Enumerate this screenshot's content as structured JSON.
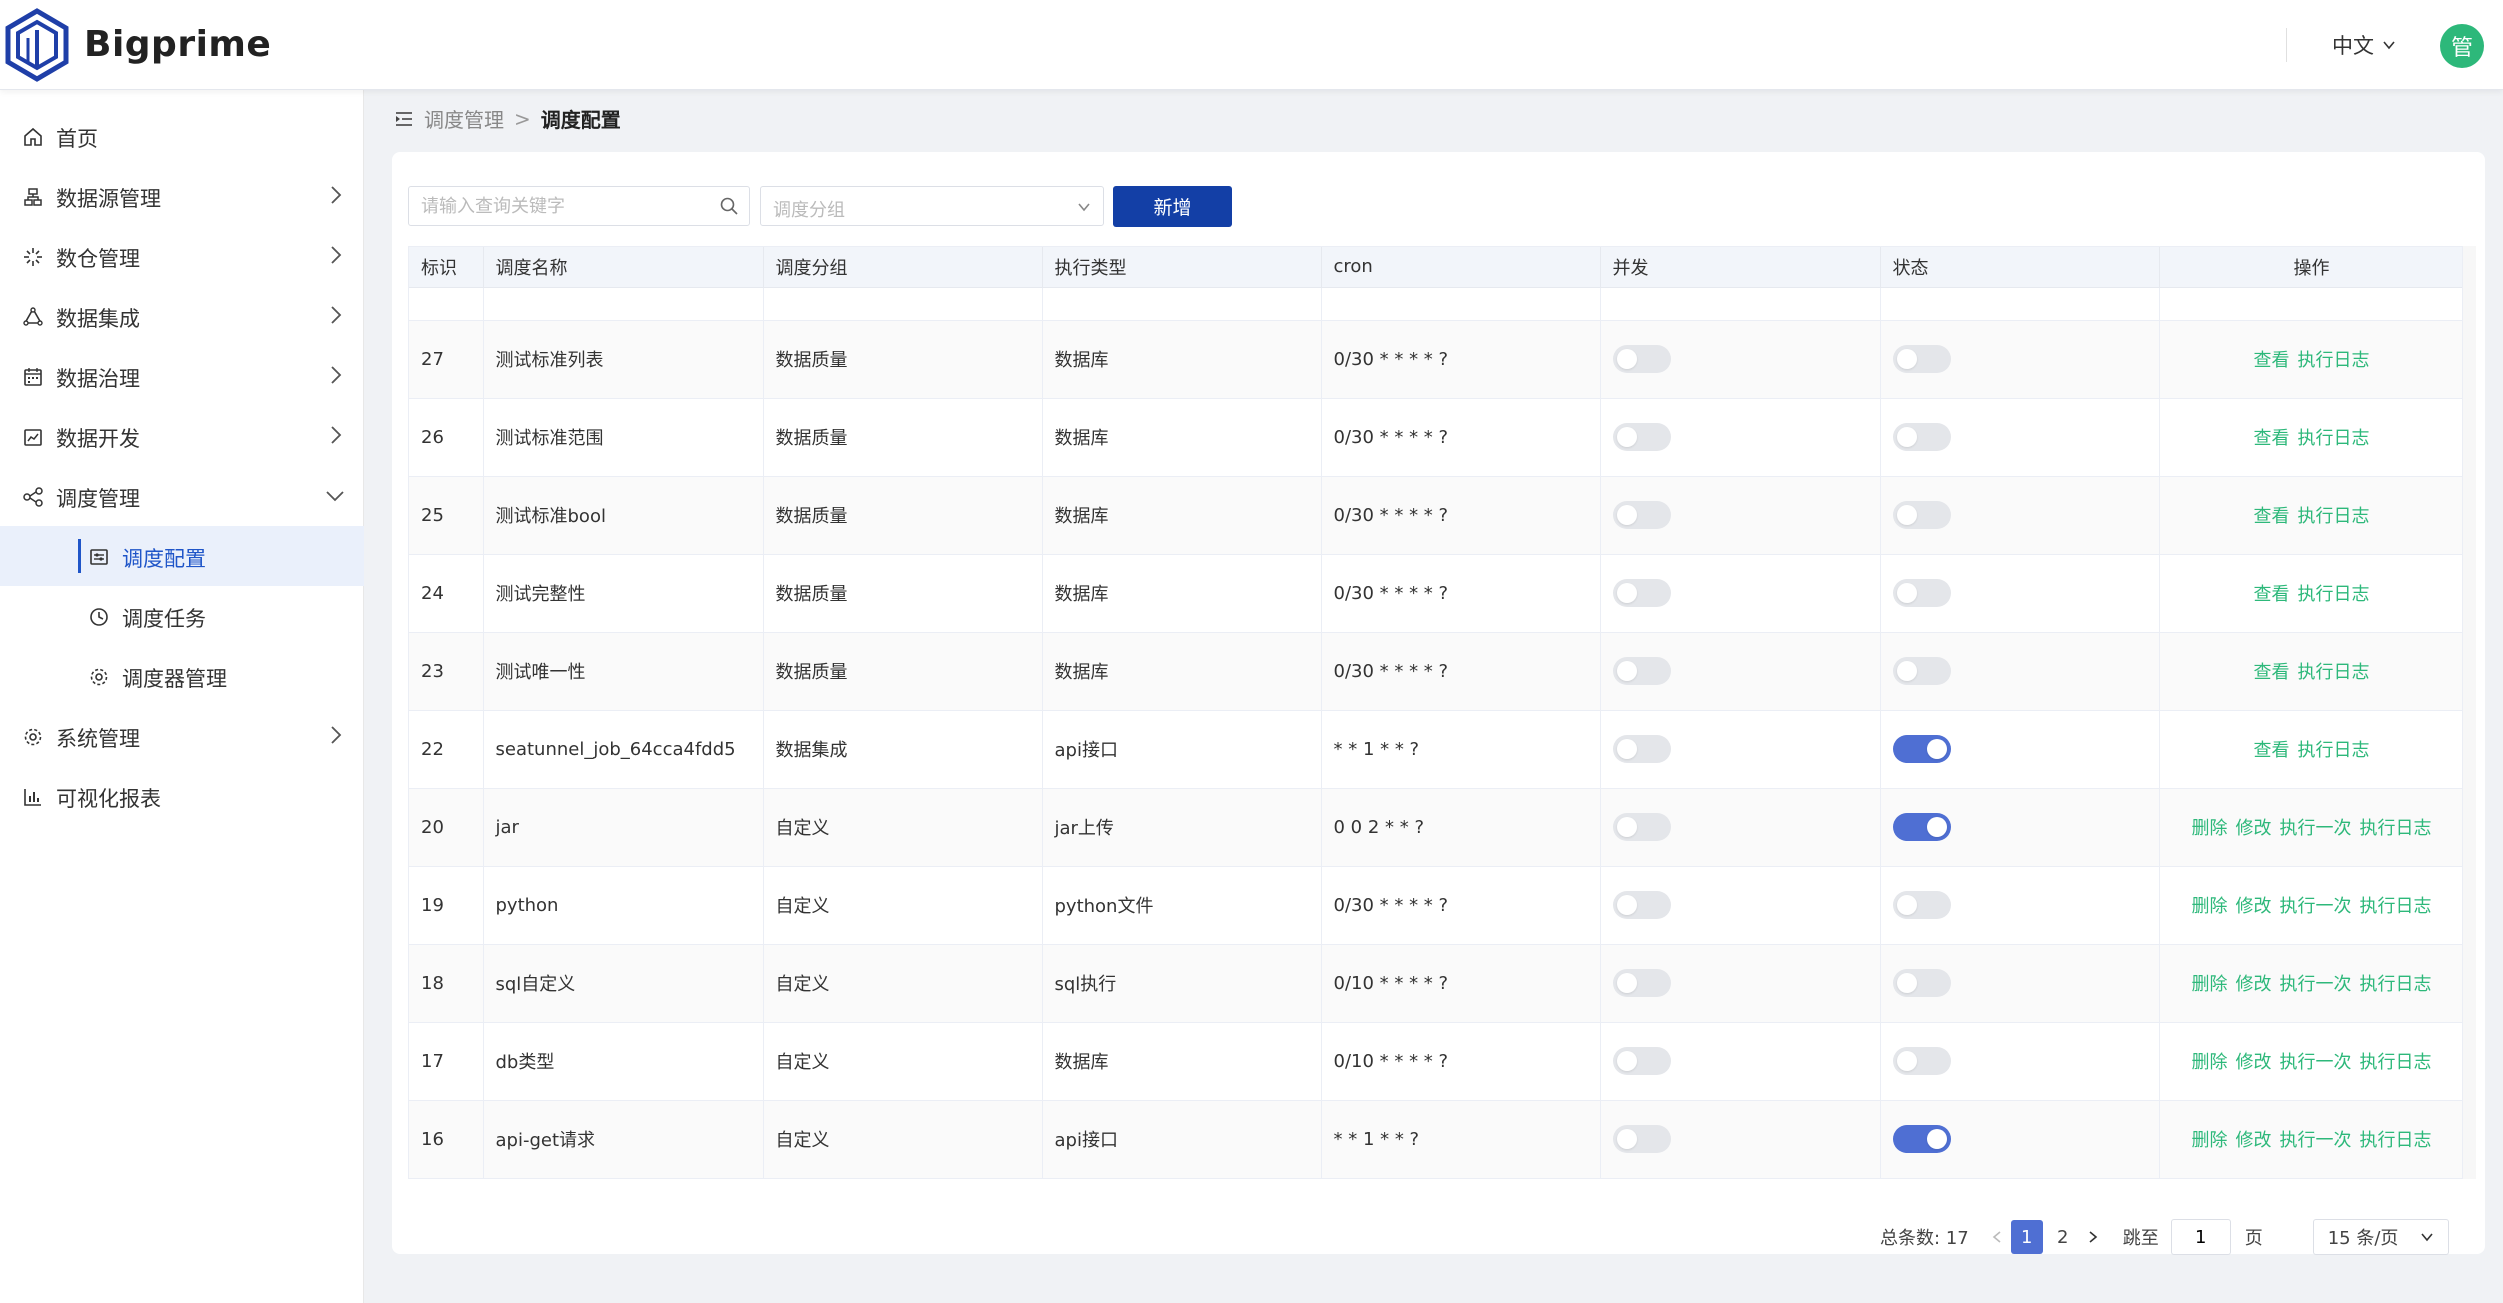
{
  "app": {
    "brand": "Bigprime"
  },
  "header": {
    "language": "中文",
    "avatar_text": "管"
  },
  "sidebar": {
    "items": [
      {
        "label": "首页",
        "icon": "home-icon"
      },
      {
        "label": "数据源管理",
        "icon": "datasource-icon"
      },
      {
        "label": "数仓管理",
        "icon": "warehouse-icon"
      },
      {
        "label": "数据集成",
        "icon": "integration-icon"
      },
      {
        "label": "数据治理",
        "icon": "governance-icon"
      },
      {
        "label": "数据开发",
        "icon": "develop-icon"
      },
      {
        "label": "调度管理",
        "icon": "share-icon"
      },
      {
        "label": "调度配置",
        "icon": "config-icon"
      },
      {
        "label": "调度任务",
        "icon": "clock-icon"
      },
      {
        "label": "调度器管理",
        "icon": "gear-icon"
      },
      {
        "label": "系统管理",
        "icon": "gear-icon"
      },
      {
        "label": "可视化报表",
        "icon": "bar-chart-icon"
      }
    ]
  },
  "breadcrumb": {
    "parent": "调度管理",
    "current": "调度配置"
  },
  "toolbar": {
    "search_placeholder": "请输入查询关键字",
    "group_placeholder": "调度分组",
    "add_label": "新增"
  },
  "table": {
    "columns": [
      "标识",
      "调度名称",
      "调度分组",
      "执行类型",
      "cron",
      "并发",
      "状态",
      "操作"
    ],
    "rows": [
      {
        "id": "27",
        "name": "测试标准列表",
        "group": "数据质量",
        "type": "数据库",
        "cron": "0/30 * * * * ?",
        "concurrent": false,
        "status": false,
        "ops": [
          "查看",
          "执行日志"
        ]
      },
      {
        "id": "26",
        "name": "测试标准范围",
        "group": "数据质量",
        "type": "数据库",
        "cron": "0/30 * * * * ?",
        "concurrent": false,
        "status": false,
        "ops": [
          "查看",
          "执行日志"
        ]
      },
      {
        "id": "25",
        "name": "测试标准bool",
        "group": "数据质量",
        "type": "数据库",
        "cron": "0/30 * * * * ?",
        "concurrent": false,
        "status": false,
        "ops": [
          "查看",
          "执行日志"
        ]
      },
      {
        "id": "24",
        "name": "测试完整性",
        "group": "数据质量",
        "type": "数据库",
        "cron": "0/30 * * * * ?",
        "concurrent": false,
        "status": false,
        "ops": [
          "查看",
          "执行日志"
        ]
      },
      {
        "id": "23",
        "name": "测试唯一性",
        "group": "数据质量",
        "type": "数据库",
        "cron": "0/30 * * * * ?",
        "concurrent": false,
        "status": false,
        "ops": [
          "查看",
          "执行日志"
        ]
      },
      {
        "id": "22",
        "name": "seatunnel_job_64cca4fdd5",
        "group": "数据集成",
        "type": "api接口",
        "cron": "* * 1 * * ?",
        "concurrent": false,
        "status": true,
        "ops": [
          "查看",
          "执行日志"
        ]
      },
      {
        "id": "20",
        "name": "jar",
        "group": "自定义",
        "type": "jar上传",
        "cron": "0 0 2 * * ?",
        "concurrent": false,
        "status": true,
        "ops": [
          "删除",
          "修改",
          "执行一次",
          "执行日志"
        ]
      },
      {
        "id": "19",
        "name": "python",
        "group": "自定义",
        "type": "python文件",
        "cron": "0/30 * * * * ?",
        "concurrent": false,
        "status": false,
        "ops": [
          "删除",
          "修改",
          "执行一次",
          "执行日志"
        ]
      },
      {
        "id": "18",
        "name": "sql自定义",
        "group": "自定义",
        "type": "sql执行",
        "cron": "0/10 * * * * ?",
        "concurrent": false,
        "status": false,
        "ops": [
          "删除",
          "修改",
          "执行一次",
          "执行日志"
        ]
      },
      {
        "id": "17",
        "name": "db类型",
        "group": "自定义",
        "type": "数据库",
        "cron": "0/10 * * * * ?",
        "concurrent": false,
        "status": false,
        "ops": [
          "删除",
          "修改",
          "执行一次",
          "执行日志"
        ]
      },
      {
        "id": "16",
        "name": "api-get请求",
        "group": "自定义",
        "type": "api接口",
        "cron": "* * 1 * * ?",
        "concurrent": false,
        "status": true,
        "ops": [
          "删除",
          "修改",
          "执行一次",
          "执行日志"
        ]
      }
    ]
  },
  "pagination": {
    "total_label": "总条数:",
    "total": "17",
    "pages": [
      "1",
      "2"
    ],
    "current_page": "1",
    "jump_label": "跳至",
    "jump_value": "1",
    "page_label": "页",
    "page_size": "15 条/页"
  },
  "colors": {
    "primary": "#133fa6",
    "accent_green": "#2db87a",
    "toggle_on": "#4f6fd3"
  }
}
